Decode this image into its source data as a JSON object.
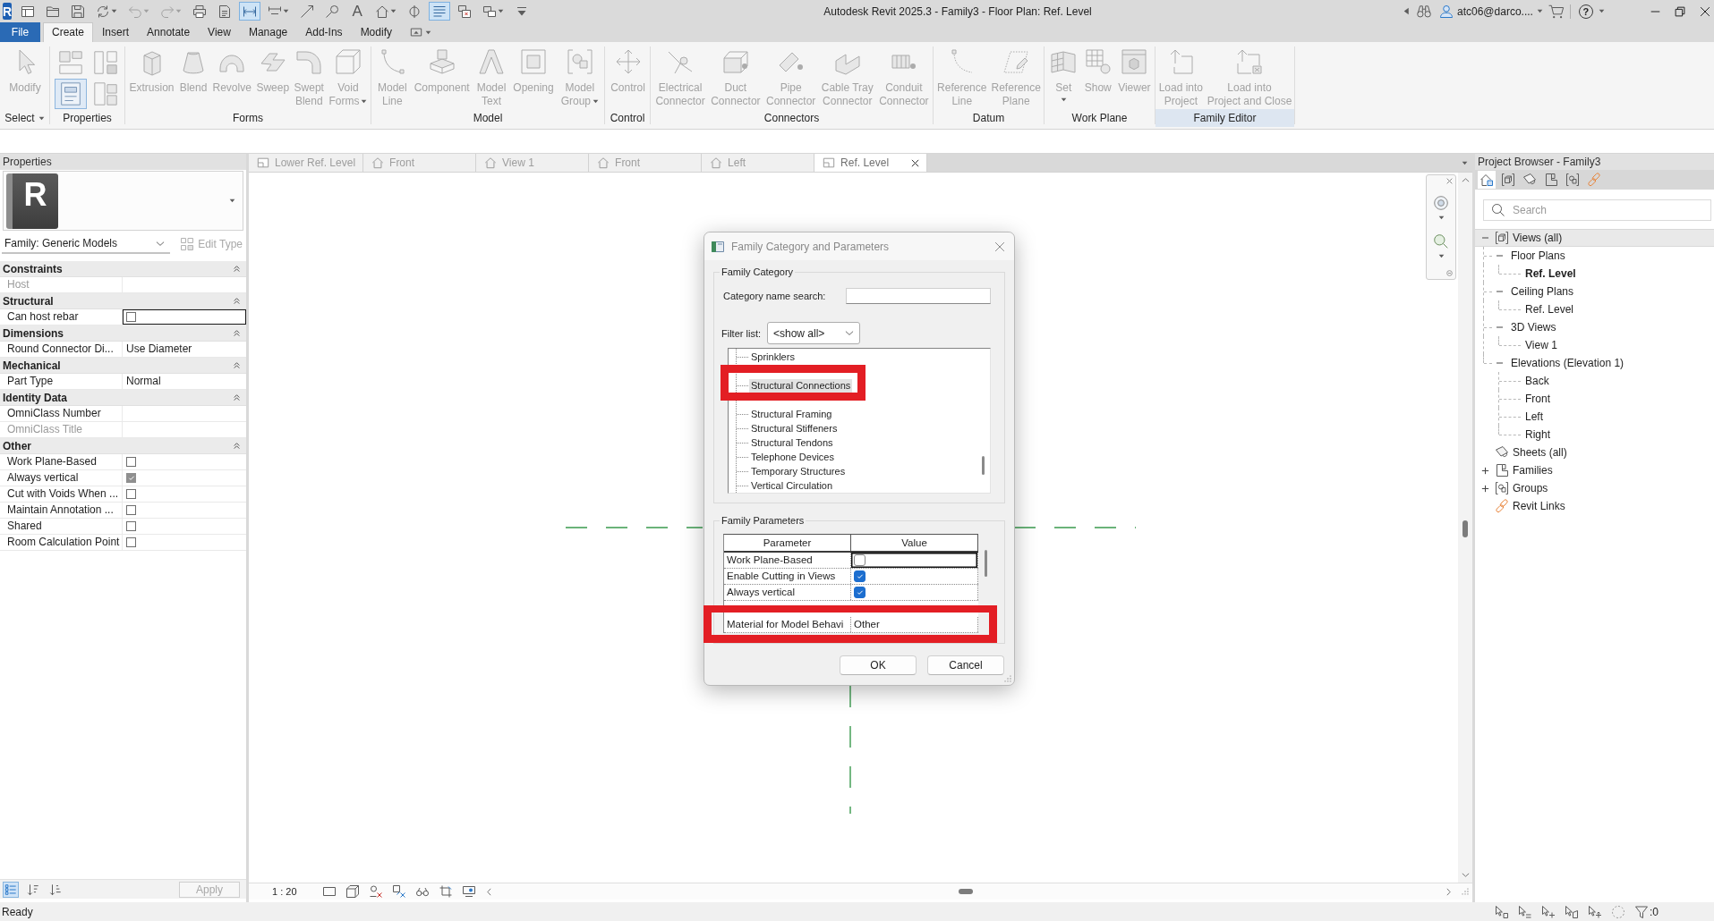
{
  "app_button": {
    "letter": "R"
  },
  "quick_access_toolbar": {
    "items": [
      {
        "on": false,
        "disabled": false,
        "dropdown": false
      },
      {
        "on": false,
        "disabled": false,
        "dropdown": false
      },
      {
        "on": false,
        "disabled": false,
        "dropdown": false
      },
      {
        "on": false,
        "disabled": false,
        "dropdown": true
      },
      {
        "on": false,
        "disabled": true,
        "dropdown": true
      },
      {
        "on": false,
        "disabled": true,
        "dropdown": true
      },
      {
        "on": false,
        "disabled": false,
        "dropdown": false
      },
      {
        "on": false,
        "disabled": false,
        "dropdown": false
      },
      {
        "on": true,
        "disabled": false,
        "dropdown": false
      },
      {
        "on": false,
        "disabled": false,
        "dropdown": true
      },
      {
        "on": false,
        "disabled": false,
        "dropdown": false
      },
      {
        "on": false,
        "disabled": false,
        "dropdown": false
      },
      {
        "glyph": "A",
        "on": false,
        "disabled": false,
        "dropdown": false
      },
      {
        "on": false,
        "disabled": false,
        "dropdown": true
      },
      {
        "on": false,
        "disabled": false,
        "dropdown": false
      },
      {
        "on": true,
        "disabled": false,
        "dropdown": false
      },
      {
        "on": false,
        "disabled": false,
        "dropdown": false
      },
      {
        "on": false,
        "disabled": false,
        "dropdown": true
      },
      {
        "on": false,
        "disabled": false,
        "dropdown": false
      }
    ]
  },
  "window": {
    "title": "Autodesk Revit 2025.3 - Family3 - Floor Plan: Ref. Level",
    "user": "atc06@darco....",
    "help_glyph": "?"
  },
  "menu_tabs": [
    {
      "label": "File",
      "kind": "application",
      "selected": false
    },
    {
      "label": "Create",
      "kind": "tab",
      "selected": true
    },
    {
      "label": "Insert",
      "kind": "tab",
      "selected": false
    },
    {
      "label": "Annotate",
      "kind": "tab",
      "selected": false
    },
    {
      "label": "View",
      "kind": "tab",
      "selected": false
    },
    {
      "label": "Manage",
      "kind": "tab",
      "selected": false
    },
    {
      "label": "Add-Ins",
      "kind": "tab",
      "selected": false
    },
    {
      "label": "Modify",
      "kind": "tab",
      "selected": false
    }
  ],
  "ribbon": {
    "panels": [
      {
        "label": "Select",
        "dropdown": true,
        "highlighted": false,
        "buttons": [
          {
            "label": "Modify",
            "disabled": true,
            "dropdown": false
          }
        ]
      },
      {
        "label": "Properties",
        "dropdown": false,
        "highlighted": false,
        "tools": [
          {
            "active": false
          },
          {
            "active": false
          },
          {
            "active": true
          },
          {
            "active": false
          }
        ]
      },
      {
        "label": "Forms",
        "dropdown": false,
        "highlighted": false,
        "buttons": [
          {
            "label": "Extrusion",
            "disabled": true,
            "dropdown": false
          },
          {
            "label": "Blend",
            "disabled": true,
            "dropdown": false
          },
          {
            "label": "Revolve",
            "disabled": true,
            "dropdown": false
          },
          {
            "label": "Sweep",
            "disabled": true,
            "dropdown": false
          },
          {
            "label": "Swept\nBlend",
            "disabled": true,
            "dropdown": false
          },
          {
            "label": "Void\nForms",
            "disabled": true,
            "dropdown": true
          }
        ]
      },
      {
        "label": "Model",
        "dropdown": false,
        "highlighted": false,
        "buttons": [
          {
            "label": "Model\nLine",
            "disabled": true,
            "dropdown": false
          },
          {
            "label": "Component",
            "disabled": true,
            "dropdown": false
          },
          {
            "label": "Model\nText",
            "disabled": true,
            "dropdown": false
          },
          {
            "label": "Opening",
            "disabled": true,
            "dropdown": false
          },
          {
            "label": "Model\nGroup",
            "disabled": true,
            "dropdown": true
          }
        ]
      },
      {
        "label": "Control",
        "dropdown": false,
        "highlighted": false,
        "buttons": [
          {
            "label": "Control",
            "disabled": true,
            "dropdown": false
          }
        ]
      },
      {
        "label": "Connectors",
        "dropdown": false,
        "highlighted": false,
        "buttons": [
          {
            "label": "Electrical\nConnector",
            "disabled": true,
            "dropdown": false
          },
          {
            "label": "Duct\nConnector",
            "disabled": true,
            "dropdown": false
          },
          {
            "label": "Pipe\nConnector",
            "disabled": true,
            "dropdown": false
          },
          {
            "label": "Cable Tray\nConnector",
            "disabled": true,
            "dropdown": false
          },
          {
            "label": "Conduit\nConnector",
            "disabled": true,
            "dropdown": false
          }
        ]
      },
      {
        "label": "Datum",
        "dropdown": false,
        "highlighted": false,
        "buttons": [
          {
            "label": "Reference\nLine",
            "disabled": true,
            "dropdown": false
          },
          {
            "label": "Reference\nPlane",
            "disabled": true,
            "dropdown": false
          }
        ]
      },
      {
        "label": "Work Plane",
        "dropdown": false,
        "highlighted": false,
        "buttons": [
          {
            "label": "Set",
            "disabled": true,
            "dropdown": true
          },
          {
            "label": "Show",
            "disabled": true,
            "dropdown": false
          },
          {
            "label": "Viewer",
            "disabled": true,
            "dropdown": false
          }
        ]
      },
      {
        "label": "Family Editor",
        "dropdown": false,
        "highlighted": true,
        "buttons": [
          {
            "label": "Load into\nProject",
            "disabled": true,
            "dropdown": false
          },
          {
            "label": "Load into\nProject and Close",
            "disabled": true,
            "dropdown": false
          }
        ]
      }
    ]
  },
  "properties": {
    "title": "Properties",
    "type_preview_letter": "R",
    "family_selector": "Family: Generic Models",
    "edit_type": {
      "label": "Edit Type",
      "disabled": true
    },
    "groups": [
      {
        "label": "Constraints",
        "expanded": true,
        "rows": [
          {
            "name": "Host",
            "read_only": true,
            "focused": false
          }
        ]
      },
      {
        "label": "Structural",
        "expanded": true,
        "rows": [
          {
            "name": "Can host rebar",
            "checked": false,
            "disabled": false,
            "read_only": false,
            "focused": true
          }
        ]
      },
      {
        "label": "Dimensions",
        "expanded": true,
        "rows": [
          {
            "name": "Round Connector Di...",
            "value": "Use Diameter",
            "read_only": false,
            "focused": false
          }
        ]
      },
      {
        "label": "Mechanical",
        "expanded": true,
        "rows": [
          {
            "name": "Part Type",
            "value": "Normal",
            "read_only": false,
            "focused": false
          }
        ]
      },
      {
        "label": "Identity Data",
        "expanded": true,
        "rows": [
          {
            "name": "OmniClass Number",
            "read_only": false,
            "focused": false
          },
          {
            "name": "OmniClass Title",
            "read_only": true,
            "focused": false
          }
        ]
      },
      {
        "label": "Other",
        "expanded": true,
        "rows": [
          {
            "name": "Work Plane-Based",
            "checked": false,
            "disabled": false,
            "read_only": false,
            "focused": false
          },
          {
            "name": "Always vertical",
            "checked": true,
            "disabled": true,
            "read_only": false,
            "focused": false
          },
          {
            "name": "Cut with Voids When ...",
            "checked": false,
            "disabled": false,
            "read_only": false,
            "focused": false
          },
          {
            "name": "Maintain Annotation ...",
            "checked": false,
            "disabled": false,
            "read_only": false,
            "focused": false
          },
          {
            "name": "Shared",
            "checked": false,
            "disabled": false,
            "read_only": false,
            "focused": false
          },
          {
            "name": "Room Calculation Point",
            "checked": false,
            "disabled": false,
            "read_only": false,
            "focused": false
          }
        ]
      }
    ],
    "sort_buttons": [
      {
        "selected": true
      },
      {
        "selected": false
      },
      {
        "selected": false
      }
    ],
    "apply_button": {
      "label": "Apply",
      "disabled": true
    }
  },
  "view_tabs": [
    {
      "label": "Lower Ref. Level",
      "kind": "plan",
      "selected": false
    },
    {
      "label": "Front",
      "kind": "elevation",
      "selected": false
    },
    {
      "label": "View 1",
      "kind": "three_d",
      "selected": false
    },
    {
      "label": "Front",
      "kind": "elevation",
      "selected": false
    },
    {
      "label": "Left",
      "kind": "elevation",
      "selected": false
    },
    {
      "label": "Ref. Level",
      "kind": "plan",
      "selected": true
    }
  ],
  "view_controls": {
    "scale": "1 : 20"
  },
  "dialog": {
    "title": "Family Category and Parameters",
    "category_group": {
      "title": "Family Category",
      "search_label": "Category name search:",
      "filter_label": "Filter list:",
      "filter_value": "<show all>",
      "items": [
        {
          "label": "Sprinklers",
          "selected": false,
          "annotated": false
        },
        {
          "label": "Structural Connections",
          "selected": true,
          "annotated": true
        },
        {
          "label": "Structural Framing",
          "selected": false,
          "annotated": false
        },
        {
          "label": "Structural Stiffeners",
          "selected": false,
          "annotated": false
        },
        {
          "label": "Structural Tendons",
          "selected": false,
          "annotated": false
        },
        {
          "label": "Telephone Devices",
          "selected": false,
          "annotated": false
        },
        {
          "label": "Temporary Structures",
          "selected": false,
          "annotated": false
        },
        {
          "label": "Vertical Circulation",
          "selected": false,
          "annotated": false
        }
      ]
    },
    "parameters_group": {
      "title": "Family Parameters",
      "columns": [
        "Parameter",
        "Value"
      ],
      "rows": [
        {
          "parameter": "Work Plane-Based",
          "checked": false,
          "focused": true,
          "annotated": false
        },
        {
          "parameter": "Enable Cutting in Views",
          "checked": true,
          "focused": false,
          "annotated": false
        },
        {
          "parameter": "Always vertical",
          "checked": true,
          "focused": false,
          "annotated": false
        },
        {
          "parameter": "Material for Model Behavi",
          "value": "Other",
          "focused": false,
          "annotated": true
        }
      ]
    },
    "buttons": [
      {
        "label": "OK"
      },
      {
        "label": "Cancel"
      }
    ]
  },
  "project_browser": {
    "title": "Project Browser - Family3",
    "toolbar": [
      {
        "selected": true
      },
      {
        "selected": false
      },
      {
        "selected": false
      },
      {
        "selected": false
      },
      {
        "selected": false
      },
      {
        "selected": false
      }
    ],
    "search": {
      "placeholder": "Search"
    },
    "tree": [
      {
        "label": "Views (all)",
        "kind": "views",
        "expanded": true,
        "selected": true,
        "children": [
          {
            "label": "Floor Plans",
            "expanded": true,
            "selected": false,
            "children": [
              {
                "label": "Ref. Level",
                "selected": false,
                "current": true
              }
            ]
          },
          {
            "label": "Ceiling Plans",
            "expanded": true,
            "selected": false,
            "children": [
              {
                "label": "Ref. Level",
                "selected": false,
                "current": false
              }
            ]
          },
          {
            "label": "3D Views",
            "expanded": true,
            "selected": false,
            "children": [
              {
                "label": "View 1",
                "selected": false,
                "current": false
              }
            ]
          },
          {
            "label": "Elevations (Elevation 1)",
            "expanded": true,
            "selected": false,
            "children": [
              {
                "label": "Back",
                "selected": false,
                "current": false
              },
              {
                "label": "Front",
                "selected": false,
                "current": false
              },
              {
                "label": "Left",
                "selected": false,
                "current": false
              },
              {
                "label": "Right",
                "selected": false,
                "current": false
              }
            ]
          }
        ]
      },
      {
        "label": "Sheets (all)",
        "kind": "sheets",
        "selected": false
      },
      {
        "label": "Families",
        "kind": "families",
        "expanded": false,
        "selected": false
      },
      {
        "label": "Groups",
        "kind": "groups",
        "expanded": false,
        "selected": false
      },
      {
        "label": "Revit Links",
        "kind": "links",
        "selected": false
      }
    ]
  },
  "status_bar": {
    "message": "Ready",
    "filter_count": ":0"
  }
}
